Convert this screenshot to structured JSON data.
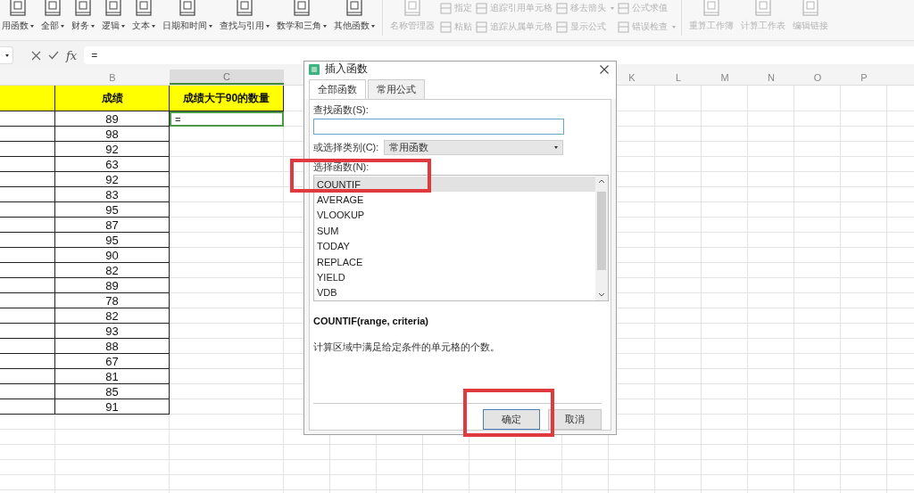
{
  "ribbon": [
    {
      "kind": "large",
      "items": [
        {
          "label": "用函数",
          "dropdown": true,
          "disabled": false
        }
      ]
    },
    {
      "kind": "large",
      "items": [
        {
          "label": "全部",
          "dropdown": true,
          "disabled": false
        }
      ]
    },
    {
      "kind": "large",
      "items": [
        {
          "label": "财务",
          "dropdown": true,
          "disabled": false
        }
      ]
    },
    {
      "kind": "large",
      "items": [
        {
          "label": "逻辑",
          "dropdown": true,
          "disabled": false
        }
      ]
    },
    {
      "kind": "large",
      "items": [
        {
          "label": "文本",
          "dropdown": true,
          "disabled": false
        }
      ]
    },
    {
      "kind": "large",
      "items": [
        {
          "label": "日期和时间",
          "dropdown": true,
          "disabled": false
        }
      ]
    },
    {
      "kind": "large",
      "items": [
        {
          "label": "查找与引用",
          "dropdown": true,
          "disabled": false
        }
      ]
    },
    {
      "kind": "large",
      "items": [
        {
          "label": "数学和三角",
          "dropdown": true,
          "disabled": false
        }
      ]
    },
    {
      "kind": "large",
      "items": [
        {
          "label": "其他函数",
          "dropdown": true,
          "disabled": false
        }
      ]
    },
    {
      "kind": "large",
      "items": [
        {
          "label": "名称管理器",
          "dropdown": false,
          "disabled": true
        }
      ]
    },
    {
      "kind": "small",
      "items": [
        {
          "label": "指定",
          "dropdown": false,
          "disabled": true
        },
        {
          "label": "粘贴",
          "dropdown": false,
          "disabled": true
        }
      ]
    },
    {
      "kind": "small",
      "items": [
        {
          "label": "追踪引用单元格",
          "dropdown": false,
          "disabled": true
        },
        {
          "label": "追踪从属单元格",
          "dropdown": false,
          "disabled": true
        }
      ]
    },
    {
      "kind": "small",
      "items": [
        {
          "label": "移去箭头",
          "dropdown": true,
          "disabled": true
        },
        {
          "label": "显示公式",
          "dropdown": false,
          "disabled": true
        }
      ]
    },
    {
      "kind": "small",
      "items": [
        {
          "label": "公式求值",
          "dropdown": false,
          "disabled": true
        },
        {
          "label": "错误检查",
          "dropdown": true,
          "disabled": true
        }
      ]
    },
    {
      "kind": "large",
      "items": [
        {
          "label": "重算工作簿",
          "dropdown": false,
          "disabled": true
        }
      ]
    },
    {
      "kind": "large",
      "items": [
        {
          "label": "计算工作表",
          "dropdown": false,
          "disabled": true
        }
      ]
    },
    {
      "kind": "large",
      "items": [
        {
          "label": "编辑链接",
          "dropdown": false,
          "disabled": true
        }
      ]
    }
  ],
  "formula_bar": {
    "fx_label": "fx",
    "value": "="
  },
  "sheet": {
    "columns": [
      {
        "letter": "B",
        "selected": false
      },
      {
        "letter": "C",
        "selected": true
      },
      {
        "letter": "K",
        "selected": false
      },
      {
        "letter": "L",
        "selected": false
      },
      {
        "letter": "M",
        "selected": false
      },
      {
        "letter": "N",
        "selected": false
      },
      {
        "letter": "O",
        "selected": false
      },
      {
        "letter": "P",
        "selected": false
      }
    ],
    "headers": [
      "成绩",
      "成绩大于90的数量"
    ],
    "active_cell_value": "=",
    "scores": [
      "89",
      "98",
      "92",
      "63",
      "92",
      "83",
      "95",
      "87",
      "95",
      "90",
      "82",
      "89",
      "78",
      "82",
      "93",
      "88",
      "67",
      "81",
      "85",
      "91"
    ]
  },
  "dialog": {
    "title": "插入函数",
    "tabs": [
      {
        "label": "全部函数",
        "selected": true
      },
      {
        "label": "常用公式",
        "selected": false
      }
    ],
    "search_label": "查找函数(S):",
    "category_label": "或选择类别(C):",
    "category_value": "常用函数",
    "list_label": "选择函数(N):",
    "functions": [
      {
        "name": "COUNTIF",
        "selected": true
      },
      {
        "name": "AVERAGE",
        "selected": false
      },
      {
        "name": "VLOOKUP",
        "selected": false
      },
      {
        "name": "SUM",
        "selected": false
      },
      {
        "name": "TODAY",
        "selected": false
      },
      {
        "name": "REPLACE",
        "selected": false
      },
      {
        "name": "YIELD",
        "selected": false
      },
      {
        "name": "VDB",
        "selected": false
      }
    ],
    "signature": "COUNTIF(range, criteria)",
    "description": "计算区域中满足给定条件的单元格的个数。",
    "buttons": [
      {
        "label": "确定",
        "kind": "primary"
      },
      {
        "label": "取消",
        "kind": "secondary"
      }
    ]
  }
}
